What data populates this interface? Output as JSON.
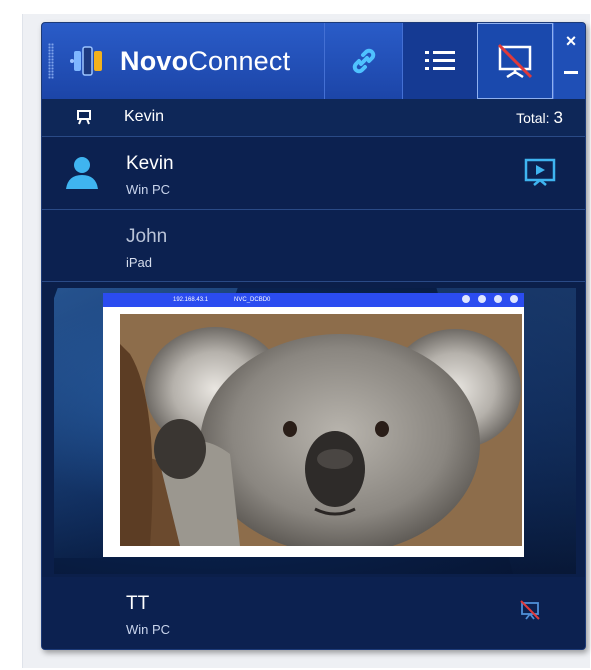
{
  "app": {
    "brand_bold": "Novo",
    "brand_rest": "Connect"
  },
  "toolbar": {
    "link_icon": "link-icon",
    "list_icon": "list-icon",
    "screen_icon": "stop-presentation-icon",
    "close_label": "×",
    "minimize_icon": "minimize-icon"
  },
  "presenter": {
    "name": "Kevin",
    "total_label": "Total:",
    "total_count": "3"
  },
  "users": [
    {
      "name": "Kevin",
      "device": "Win PC"
    },
    {
      "name": "John",
      "device": "iPad"
    },
    {
      "name": "TT",
      "device": "Win PC"
    }
  ],
  "preview": {
    "toolbar_ip": "192.168.43.1",
    "toolbar_ssid": "NVC_DCBD0"
  },
  "colors": {
    "toolbar_blue": "#2a5cc8",
    "panel_navy": "#0b1f4a",
    "accent_cyan": "#3fb4f0",
    "stop_red": "#e03a3a"
  }
}
